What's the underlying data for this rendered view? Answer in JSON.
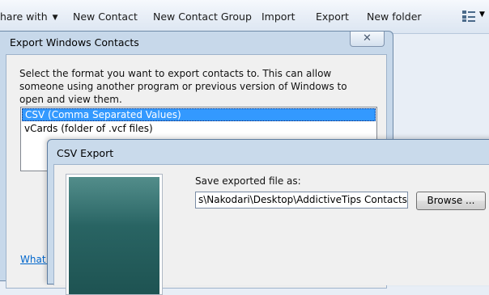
{
  "toolbar": {
    "items": [
      {
        "label": "hare with",
        "has_dropdown": true
      },
      {
        "label": "New Contact"
      },
      {
        "label": "New Contact Group"
      },
      {
        "label": "Import"
      },
      {
        "label": "Export"
      },
      {
        "label": "New folder"
      }
    ],
    "view_icon": "view-options-icon"
  },
  "export_dialog": {
    "title": "Export Windows Contacts",
    "close_glyph": "✕",
    "instruction": "Select the format you want to export contacts to.  This can allow someone using another program or previous version of Windows to open and view them.",
    "formats": [
      {
        "label": "CSV (Comma Separated Values)",
        "selected": true
      },
      {
        "label": "vCards (folder of .vcf files)",
        "selected": false
      }
    ],
    "help_link": "What fi"
  },
  "csv_dialog": {
    "title": "CSV Export",
    "save_label": "Save exported file as:",
    "file_path": "s\\Nakodari\\Desktop\\AddictiveTips Contacts.csv",
    "browse_label": "Browse ..."
  },
  "colors": {
    "selection": "#3399ff",
    "link": "#0066cc",
    "wizard_panel": "#2a6665",
    "title_bar": "#c7d8ea"
  }
}
